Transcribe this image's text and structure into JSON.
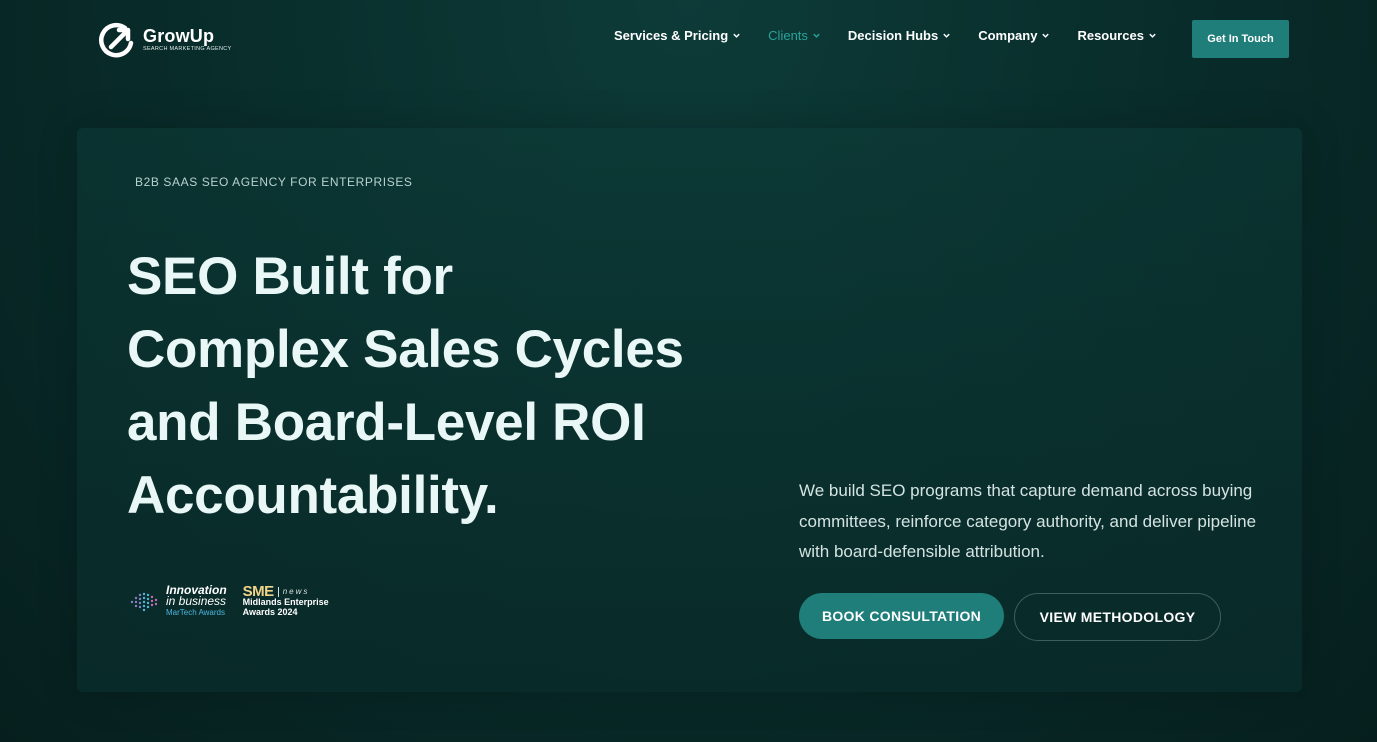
{
  "brand": {
    "name": "GrowUp",
    "tagline": "Search Marketing Agency",
    "logo_icon": "growth-arrow-g-icon"
  },
  "nav": {
    "items": [
      {
        "label": "Services & Pricing",
        "active": false
      },
      {
        "label": "Clients",
        "active": true
      },
      {
        "label": "Decision Hubs",
        "active": false
      },
      {
        "label": "Company",
        "active": false
      },
      {
        "label": "Resources",
        "active": false
      }
    ],
    "cta_label": "Get In Touch"
  },
  "hero": {
    "eyebrow": "B2B SAAS SEO AGENCY FOR ENTERPRISES",
    "headline_lines": [
      "SEO Built for",
      "Complex Sales Cycles",
      "and Board-Level ROI",
      "Accountability."
    ],
    "description": "We build SEO programs that capture demand across buying committees, reinforce category authority, and deliver pipeline with board-defensible attribution.",
    "primary_button": "BOOK CONSULTATION",
    "secondary_button": "VIEW METHODOLOGY"
  },
  "awards": {
    "iib": {
      "line1": "Innovation",
      "line2": "in business",
      "line3": "MarTech Awards"
    },
    "sme": {
      "logo": "SME",
      "news": "news",
      "line1": "Midlands Enterprise",
      "line2": "Awards 2024"
    }
  },
  "colors": {
    "background": "#082b29",
    "accent": "#1f7d7a",
    "active_nav": "#2aa39a",
    "headline": "#e9f7f6"
  }
}
